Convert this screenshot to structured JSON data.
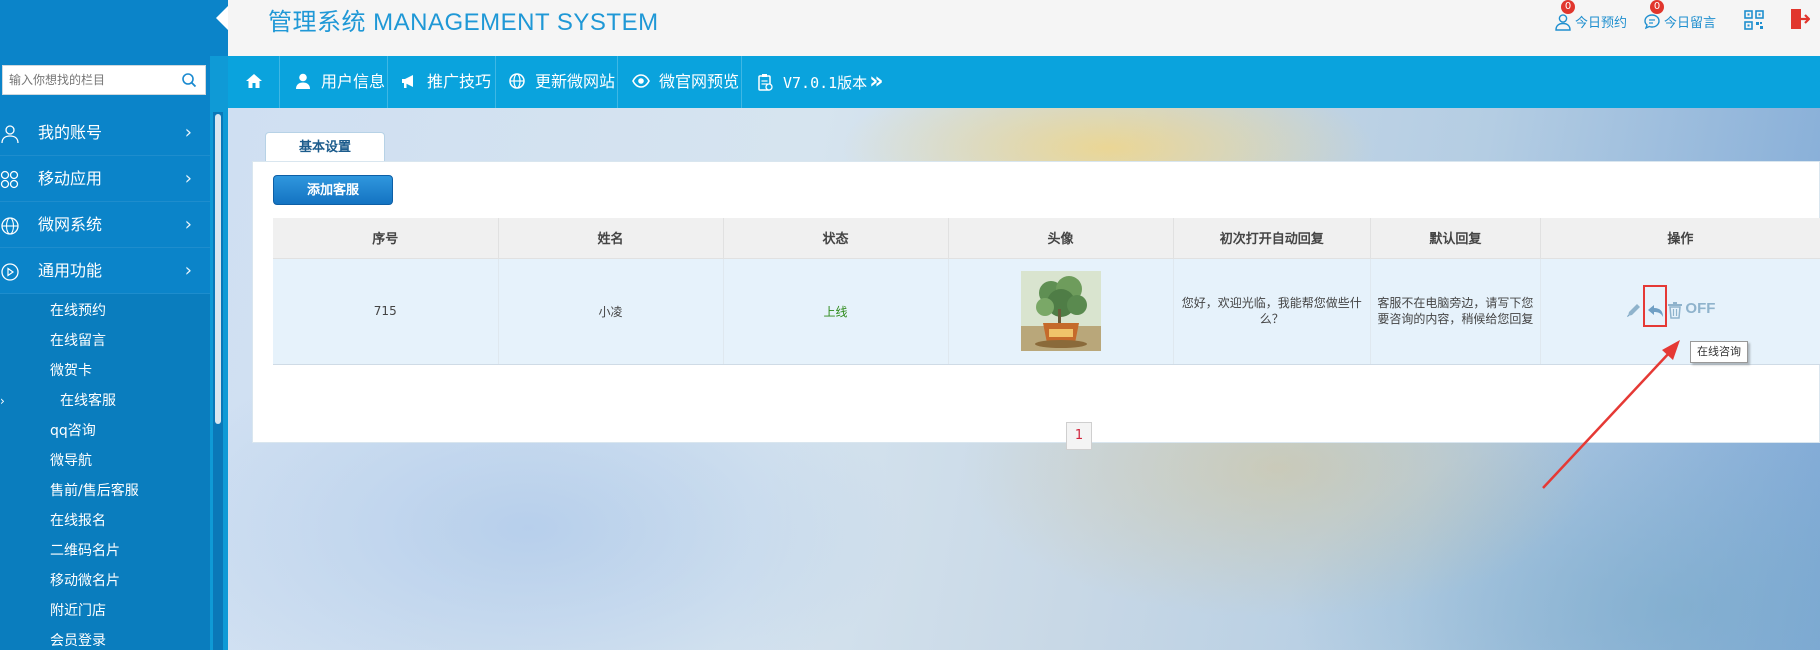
{
  "header": {
    "brand": "管理系统 MANAGEMENT SYSTEM",
    "links": [
      {
        "label": "今日预约",
        "badge": "0",
        "icon": "user-icon"
      },
      {
        "label": "今日留言",
        "badge": "0",
        "icon": "chat-icon"
      }
    ],
    "qr_icon": "qrcode-icon",
    "exit_icon": "logout-icon"
  },
  "sidebar": {
    "search_placeholder": "输入你想找的栏目",
    "menu": [
      {
        "label": "我的账号",
        "icon": "user-icon"
      },
      {
        "label": "移动应用",
        "icon": "apps-icon"
      },
      {
        "label": "微网系统",
        "icon": "globe-icon"
      },
      {
        "label": "通用功能",
        "icon": "play-circle-icon"
      }
    ],
    "submenu": [
      "在线预约",
      "在线留言",
      "微贺卡",
      "在线客服",
      "qq咨询",
      "微导航",
      "售前/售后客服",
      "在线报名",
      "二维码名片",
      "移动微名片",
      "附近门店",
      "会员登录"
    ],
    "current_marker": "›"
  },
  "navbar": {
    "items": [
      {
        "label": "用户信息",
        "icon": "user-icon"
      },
      {
        "label": "推广技巧",
        "icon": "megaphone-icon"
      },
      {
        "label": "更新微网站",
        "icon": "globe-icon"
      },
      {
        "label": "微官网预览",
        "icon": "eye-icon"
      },
      {
        "label": "V7.0.1版本",
        "icon": "clipboard-icon"
      }
    ],
    "more": "»"
  },
  "main": {
    "tab": "基本设置",
    "add_button": "添加客服",
    "table": {
      "columns": [
        "序号",
        "姓名",
        "状态",
        "头像",
        "初次打开自动回复",
        "默认回复",
        "操作"
      ],
      "rows": [
        {
          "id": "715",
          "name": "小凌",
          "status": "上线",
          "auto_reply": "您好，欢迎光临，我能帮您做些什么？",
          "default_reply": "客服不在电脑旁边，请写下您要咨询的内容，稍候给您回复",
          "off_label": "OFF"
        }
      ]
    },
    "tooltip": "在线咨询",
    "page": "1"
  },
  "colors": {
    "sidebar": "#0b84c9",
    "navbar": "#0aa3dd",
    "brand": "#1f98d6",
    "status_online": "#2e8b1b",
    "badge": "#e1362d",
    "highlight": "#e53935"
  }
}
